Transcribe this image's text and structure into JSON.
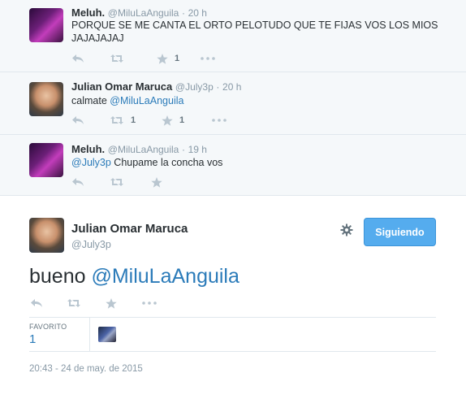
{
  "replies": [
    {
      "fullname": "Meluh.",
      "handle": "@MiluLaAnguila",
      "separator": "·",
      "time": "20 h",
      "text": "PORQUE SE ME CANTA EL ORTO PELOTUDO QUE TE FIJAS VOS LOS MIOS JAJAJAJAJ",
      "retweets": "",
      "favorites": "1"
    },
    {
      "fullname": "Julian Omar Maruca",
      "handle": "@July3p",
      "separator": "·",
      "time": "20 h",
      "text_prefix": "calmate ",
      "mention": "@MiluLaAnguila",
      "retweets": "1",
      "favorites": "1"
    },
    {
      "fullname": "Meluh.",
      "handle": "@MiluLaAnguila",
      "separator": "·",
      "time": "19 h",
      "mention": "@July3p",
      "text_suffix": " Chupame la concha vos",
      "retweets": "",
      "favorites": ""
    }
  ],
  "main_tweet": {
    "fullname": "Julian Omar Maruca",
    "handle": "@July3p",
    "follow_label": "Siguiendo",
    "text_prefix": "bueno ",
    "mention": "@MiluLaAnguila",
    "stats": {
      "favorites_label": "FAVORITO",
      "favorites_value": "1"
    },
    "timestamp": "20:43 - 24 de may. de 2015"
  },
  "icons": {
    "reply": "reply-icon",
    "retweet": "retweet-icon",
    "favorite": "star-icon",
    "more": "more-icon",
    "settings": "gear-icon"
  },
  "colors": {
    "link": "#2b7bb9",
    "follow_button": "#55acee",
    "reply_background": "#f5f8fa",
    "muted_text": "#8899a6"
  }
}
